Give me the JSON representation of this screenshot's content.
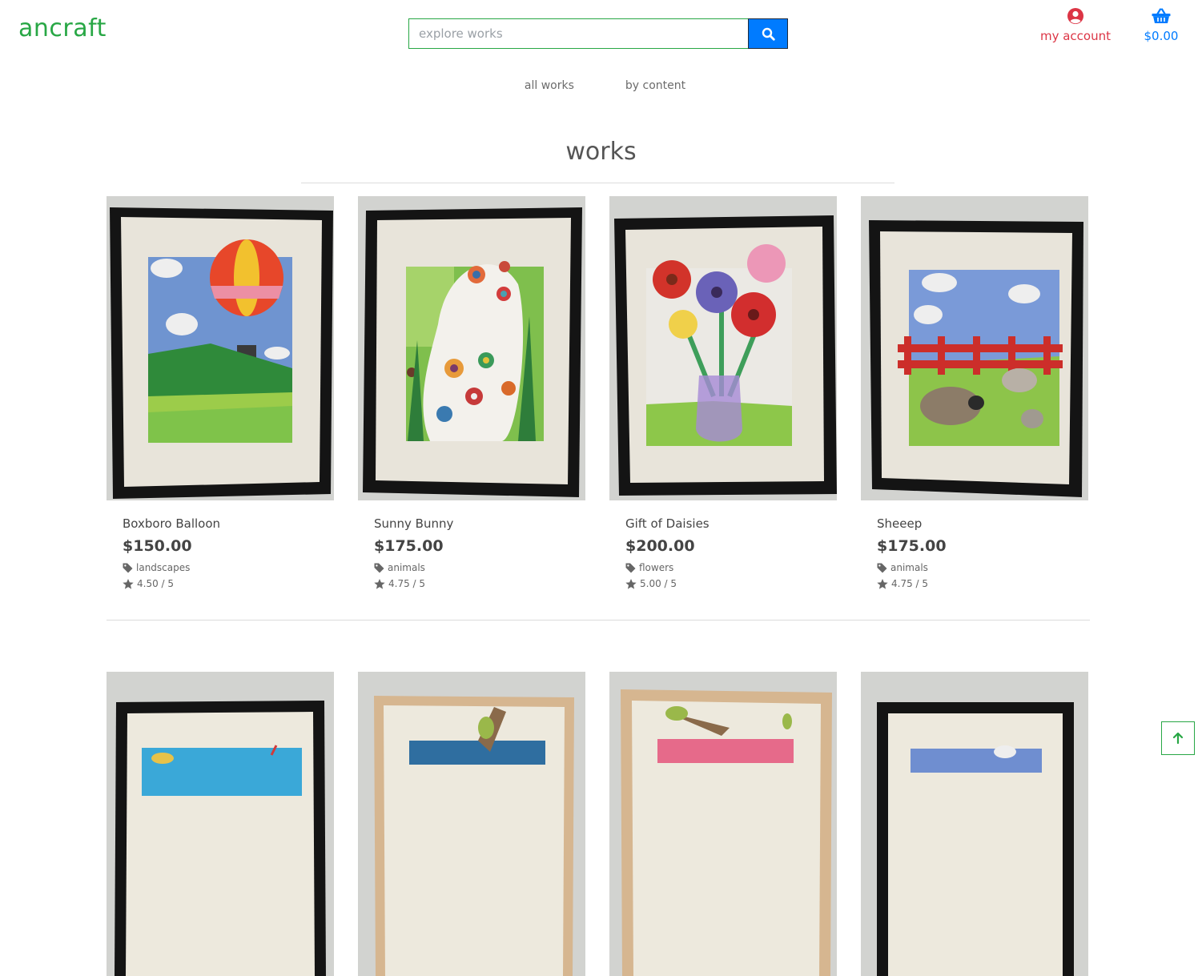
{
  "brand": {
    "logo_text": "ancraft",
    "accent": "#28a745"
  },
  "search": {
    "placeholder": "explore works",
    "value": "",
    "button_icon": "search-icon"
  },
  "account": {
    "label": "my account",
    "icon": "user-circle-icon",
    "color": "#dc3545"
  },
  "cart": {
    "total": "$0.00",
    "icon": "basket-icon",
    "color": "#007bff"
  },
  "nav": {
    "items": [
      {
        "label": "all works"
      },
      {
        "label": "by content"
      }
    ]
  },
  "page": {
    "title": "works"
  },
  "works": [
    {
      "title": "Boxboro Balloon",
      "price": "$150.00",
      "category": "landscapes",
      "rating": "4.50 / 5"
    },
    {
      "title": "Sunny Bunny",
      "price": "$175.00",
      "category": "animals",
      "rating": "4.75 / 5"
    },
    {
      "title": "Gift of Daisies",
      "price": "$200.00",
      "category": "flowers",
      "rating": "5.00 / 5"
    },
    {
      "title": "Sheeep",
      "price": "$175.00",
      "category": "animals",
      "rating": "4.75 / 5"
    }
  ],
  "back_to_top": {
    "icon": "arrow-up-icon"
  }
}
